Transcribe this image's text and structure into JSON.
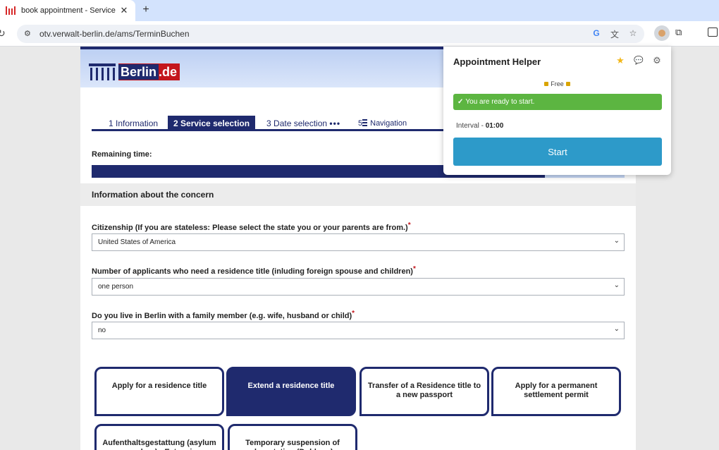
{
  "browser": {
    "tab_title": "book appointment - Service",
    "tab_close": "✕",
    "new_tab": "+",
    "reload": "↻",
    "site_info": "⚙",
    "url": "otv.verwalt-berlin.de/ams/TerminBuchen",
    "google_icon": "G",
    "translate_icon": "文",
    "star_icon": "☆",
    "puzzle_icon": "⧉"
  },
  "header": {
    "logo_text": "Berlin",
    "logo_suffix": ".de"
  },
  "steps": [
    {
      "number": "1",
      "label": "Information"
    },
    {
      "number": "2",
      "label": "Service selection"
    },
    {
      "number": "3",
      "label": "Date selection",
      "suffix": "•••"
    },
    {
      "number": "5",
      "label": "Navigation"
    }
  ],
  "remaining_label": "Remaining time:",
  "progress": {
    "fraction": 0.85
  },
  "section_title": "Information about the concern",
  "fields": [
    {
      "label": "Citizenship (If you are stateless: Please select the state you or your parents are from.)",
      "required": "*",
      "value": "United States of America"
    },
    {
      "label": "Number of applicants who need a residence title (inluding foreign spouse and children)",
      "required": "*",
      "value": "one person"
    },
    {
      "label": "Do you live in Berlin with a family member (e.g. wife, husband or child)",
      "required": "*",
      "value": "no"
    }
  ],
  "chevron": "⌄",
  "options": [
    {
      "label": "Apply for a residence title"
    },
    {
      "label": "Extend a residence title"
    },
    {
      "label": "Transfer of a Residence title to a new passport"
    },
    {
      "label": "Apply for a permanent settlement permit"
    },
    {
      "label": "Aufenthaltsgestattung (asylum procedure) - Extension"
    },
    {
      "label": "Temporary suspension of deportation (Duldung)"
    }
  ],
  "popup": {
    "title": "Appointment Helper",
    "star_icon": "★",
    "chat_icon": "💬",
    "gear_icon": "⚙",
    "plan": "Free",
    "ready_check": "✓",
    "ready_text": "You are ready to start.",
    "interval_label": "Interval -",
    "interval_value": "01:00",
    "start_label": "Start"
  },
  "colors": {
    "brand_navy": "#1f2a6e",
    "brand_red": "#c4161c",
    "ready_green": "#5cb541",
    "start_blue": "#2d9ac9"
  }
}
